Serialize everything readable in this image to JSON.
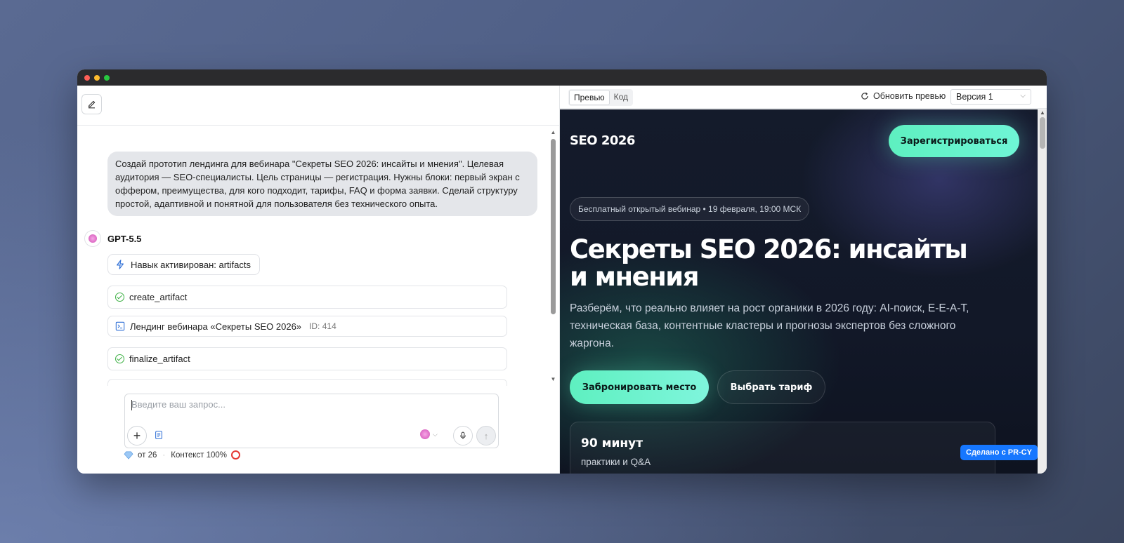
{
  "chat": {
    "user_message": "Создай прототип лендинга для вебинара \"Секреты SEO 2026: инсайты и мнения\". Целевая аудитория — SEO-специалисты. Цель страницы — регистрация. Нужны блоки: первый экран с оффером, преимущества, для кого подходит, тарифы, FAQ и форма заявки. Сделай структуру простой, адаптивной и понятной для пользователя без технического опыта.",
    "bot_name": "GPT-5.5",
    "skill_label": "Навык активирован: artifacts",
    "steps": {
      "create": "create_artifact",
      "artifact_title": "Лендинг вебинара «Секреты SEO 2026»",
      "artifact_id": "ID: 414",
      "finalize": "finalize_artifact"
    },
    "composer": {
      "placeholder": "Введите ваш запрос..."
    },
    "footer": {
      "credits": "от 26",
      "context": "Контекст 100%"
    }
  },
  "preview_toolbar": {
    "tab_preview": "Превью",
    "tab_code": "Код",
    "refresh_label": "Обновить превью",
    "version": "Версия 1"
  },
  "site": {
    "brand": "SEO 2026",
    "register_button": "Зарегистрироваться",
    "badge": "Бесплатный открытый вебинар • 19 февраля, 19:00 МСК",
    "title": "Секреты SEO 2026: инсайты и мнения",
    "subtitle": "Разберём, что реально влияет на рост органики в 2026 году: AI-поиск, E-E-A-T, техническая база, контентные кластеры и прогнозы экспертов без сложного жаргона.",
    "primary_button": "Забронировать место",
    "secondary_button": "Выбрать тариф",
    "stat_value": "90 минут",
    "stat_label": "практики и Q&A",
    "made_with": "Сделано с PR-CY"
  },
  "colors": {
    "accent": "#5ef0c0",
    "badge_blue": "#1677ff",
    "site_bg": "#121828"
  }
}
